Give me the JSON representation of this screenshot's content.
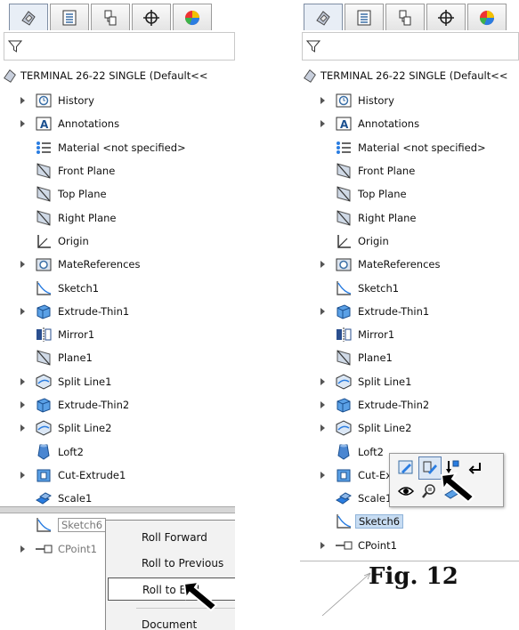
{
  "toolbar_tabs": [
    "feature-manager-tab",
    "property-manager-tab",
    "configuration-manager-tab",
    "dimxpert-manager-tab",
    "display-manager-tab"
  ],
  "left": {
    "root_label": "TERMINAL 26-22 SINGLE  (Default<<",
    "items": [
      {
        "label": "History"
      },
      {
        "label": "Annotations"
      },
      {
        "label": "Material <not specified>"
      },
      {
        "label": "Front Plane"
      },
      {
        "label": "Top Plane"
      },
      {
        "label": "Right Plane"
      },
      {
        "label": "Origin"
      },
      {
        "label": "MateReferences"
      },
      {
        "label": "Sketch1"
      },
      {
        "label": "Extrude-Thin1"
      },
      {
        "label": "Mirror1"
      },
      {
        "label": "Plane1"
      },
      {
        "label": "Split Line1"
      },
      {
        "label": "Extrude-Thin2"
      },
      {
        "label": "Split Line2"
      },
      {
        "label": "Loft2"
      },
      {
        "label": "Cut-Extrude1"
      },
      {
        "label": "Scale1"
      },
      {
        "label": "Sketch6"
      },
      {
        "label": "CPoint1"
      }
    ],
    "context_menu": [
      "Roll Forward",
      "Roll to Previous",
      "Roll to End",
      "Document Properties..."
    ]
  },
  "right": {
    "root_label": "TERMINAL 26-22 SINGLE  (Default<<",
    "items": [
      {
        "label": "History"
      },
      {
        "label": "Annotations"
      },
      {
        "label": "Material <not specified>"
      },
      {
        "label": "Front Plane"
      },
      {
        "label": "Top Plane"
      },
      {
        "label": "Right Plane"
      },
      {
        "label": "Origin"
      },
      {
        "label": "MateReferences"
      },
      {
        "label": "Sketch1"
      },
      {
        "label": "Extrude-Thin1"
      },
      {
        "label": "Mirror1"
      },
      {
        "label": "Plane1"
      },
      {
        "label": "Split Line1"
      },
      {
        "label": "Extrude-Thin2"
      },
      {
        "label": "Split Line2"
      },
      {
        "label": "Loft2"
      },
      {
        "label": "Cut-Ext"
      },
      {
        "label": "Scale1"
      },
      {
        "label": "Sketch6"
      },
      {
        "label": "CPoint1"
      }
    ]
  },
  "caption": "Fig. 12",
  "colors": {
    "selection": "#c7dcf2",
    "rollback_bar": "#d6d6d6"
  }
}
